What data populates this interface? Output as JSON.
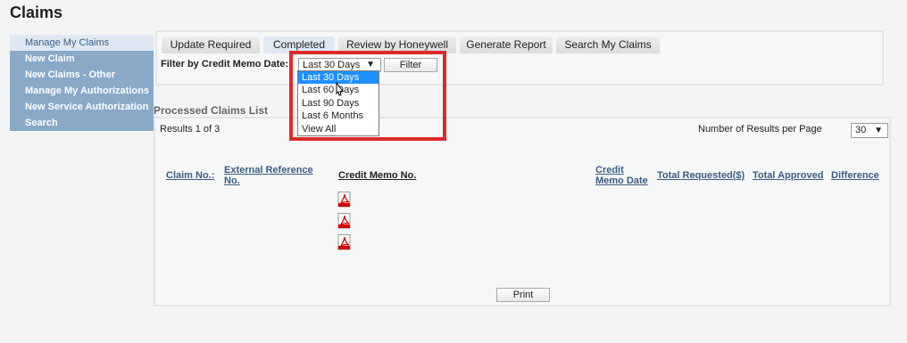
{
  "page": {
    "title": "Claims"
  },
  "sidebar": {
    "items": [
      {
        "label": "Manage My Claims"
      },
      {
        "label": "New Claim"
      },
      {
        "label": "New Claims - Other"
      },
      {
        "label": "Manage My Authorizations"
      },
      {
        "label": "New Service Authorization"
      },
      {
        "label": "Search"
      }
    ]
  },
  "tabs": [
    {
      "label": "Update Required"
    },
    {
      "label": "Completed"
    },
    {
      "label": "Review by Honeywell"
    },
    {
      "label": "Generate Report"
    },
    {
      "label": "Search My Claims"
    }
  ],
  "filter": {
    "label": "Filter by Credit Memo Date:",
    "selected": "Last 30 Days",
    "button_label": "Filter",
    "options": [
      "Last 30 Days",
      "Last 60 Days",
      "Last 90 Days",
      "Last 6 Months",
      "View All"
    ]
  },
  "processed": {
    "title": "Processed Claims List",
    "results_text": "Results 1 of 3",
    "per_page_label": "Number of Results per Page",
    "per_page_value": "30",
    "columns": {
      "claim_no": "Claim No.:",
      "external_ref_1": "External Reference",
      "external_ref_2": "No.",
      "credit_memo_no": "Credit Memo No.",
      "credit_memo_date_1": "Credit",
      "credit_memo_date_2": "Memo Date",
      "total_requested": "Total Requested($)",
      "total_approved": "Total Approved",
      "difference": "Difference"
    },
    "print_label": "Print"
  },
  "colors": {
    "sidebar_bg": "#8aa9c9",
    "link": "#3a5d84",
    "highlight_box": "#dd2a2a",
    "selected_option": "#1e90ff"
  }
}
